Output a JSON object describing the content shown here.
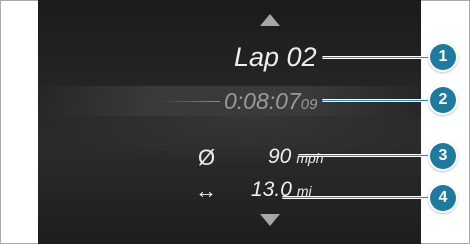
{
  "display": {
    "lap_label": "Lap 02",
    "time_main": "0:08:07",
    "time_fraction": "09",
    "average_symbol": "Ø",
    "speed_value": "90",
    "speed_unit": "mph",
    "distance_symbol": "↔",
    "distance_value": "13.0",
    "distance_unit": "mi"
  },
  "callouts": [
    "1",
    "2",
    "3",
    "4"
  ],
  "colors": {
    "screen_background": "#262626",
    "text": "#eeeeee",
    "time_text": "#9a9a9a",
    "badge": "#1f7aa0",
    "callout_line": "#2a8fb4"
  },
  "icons": {
    "scroll_up": "triangle-up-icon",
    "scroll_down": "triangle-down-icon"
  }
}
